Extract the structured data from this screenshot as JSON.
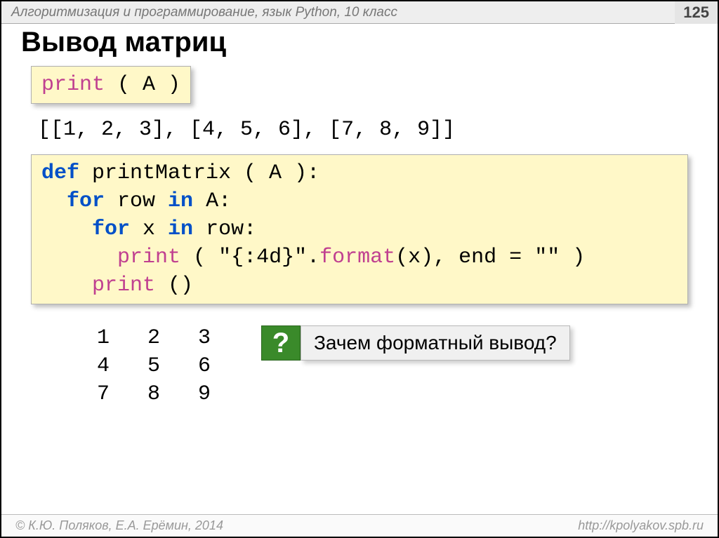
{
  "header": {
    "breadcrumb": "Алгоритмизация и программирование, язык Python, 10 класс",
    "page_number": "125"
  },
  "title": "Вывод матриц",
  "code": {
    "print_call": {
      "print": "print",
      "open": " ( ",
      "arg": "A",
      "close": " )"
    },
    "raw_output": "[[1, 2, 3], [4, 5, 6], [7, 8, 9]]",
    "func_def": {
      "def": "def",
      "name": " printMatrix ( A ):",
      "for1_kw": "for",
      "for1_rest": " row ",
      "for1_in": "in",
      "for1_a": " A:",
      "for2_kw": "for",
      "for2_rest": " x ",
      "for2_in": "in",
      "for2_row": " row:",
      "print1": "print",
      "print1_args_a": " ( ",
      "print1_str": "\"{:4d}\"",
      "print1_dot": ".",
      "print1_format": "format",
      "print1_args_b": "(x), end",
      "print1_eq": " = ",
      "print1_empty": "\"\"",
      "print1_close": " )",
      "print2": "print",
      "print2_args": " ()"
    },
    "matrix_output": "  1   2   3\n  4   5   6\n  7   8   9"
  },
  "callout": {
    "badge": "?",
    "text": "Зачем форматный вывод?"
  },
  "footer": {
    "left": "© К.Ю. Поляков, Е.А. Ерёмин, 2014",
    "right": "http://kpolyakov.spb.ru"
  }
}
